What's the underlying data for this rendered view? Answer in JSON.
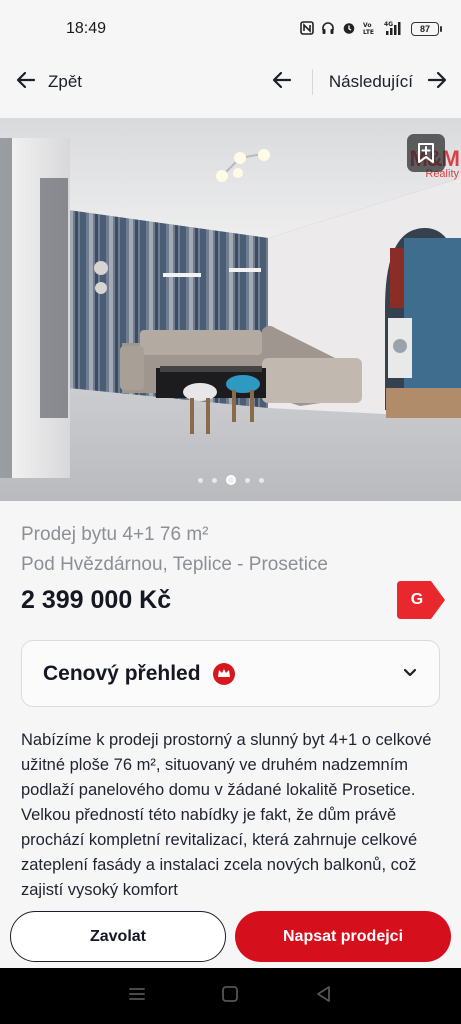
{
  "status_bar": {
    "time": "18:49",
    "battery": "87",
    "network": "4G",
    "icons": [
      "nfc-icon",
      "headset-icon",
      "alarm-icon",
      "volte-icon",
      "signal-icon",
      "battery-icon"
    ]
  },
  "nav": {
    "back_label": "Zpět",
    "next_label": "Následující"
  },
  "gallery": {
    "watermark_brand": "M&M",
    "watermark_sub": "Reality",
    "total_photos": 5,
    "active_photo_index": 3
  },
  "listing": {
    "title": "Prodej bytu 4+1 76 m²",
    "address": "Pod Hvězdárnou, Teplice - Prosetice",
    "price": "2 399 000 Kč",
    "energy_class": "G",
    "energy_color": "#e8282d"
  },
  "price_overview": {
    "label": "Cenový přehled"
  },
  "description": {
    "text": "Nabízíme k prodeji prostorný a slunný byt 4+1 o celkové užitné ploše 76 m², situovaný ve druhém nadzemním podlaží panelového domu v žádané lokalitě Prosetice. Velkou předností této nabídky je fakt, že dům právě prochází kompletní revitalizací, která zahrnuje celkové zateplení fasády a instalaci zcela nových balkonů, což zajistí vysoký komfort"
  },
  "actions": {
    "call_label": "Zavolat",
    "write_label": "Napsat prodejci",
    "accent_color": "#d5101c"
  }
}
